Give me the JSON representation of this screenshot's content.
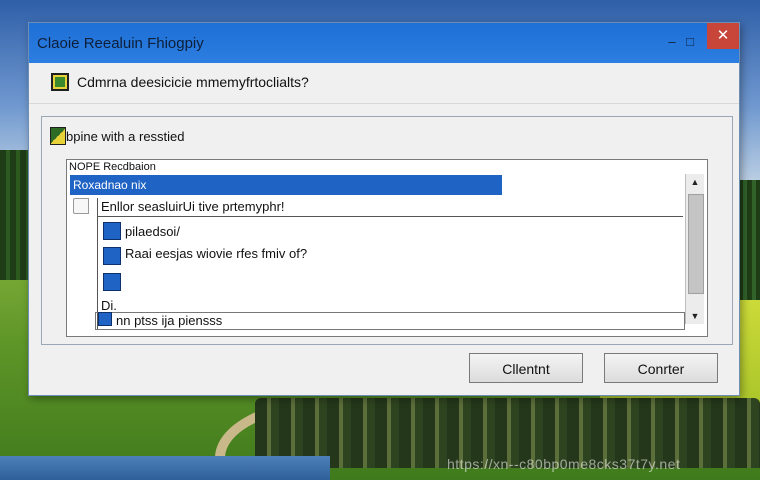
{
  "dialog": {
    "title": "Claoie Reealuin Fhiogpiy",
    "minimize_glyph": "–",
    "maximize_glyph": "□",
    "close_glyph": "✕",
    "question": "Cdmrna deesicicie mmemyfrtoclialts?",
    "group_label": "bpine with a resstied",
    "list": {
      "header": "NOPE Recdbaion",
      "selected_row": "Roxadnao nix",
      "rows": [
        "Enllor seasluirUi tive prtemyphr!",
        "pilaedsoi/",
        "Raai eesjas wiovie rfes fmiv of?",
        "",
        "Di.",
        "nn ptss ija piensss"
      ]
    },
    "buttons": {
      "primary": "Cllentnt",
      "secondary": "Conrter"
    },
    "colors": {
      "titlebar": "#1e6fd6",
      "selection": "#1f63c4",
      "close": "#c8453a"
    }
  },
  "watermark": "https://xn--c80bp0me8cks37t7y.net"
}
